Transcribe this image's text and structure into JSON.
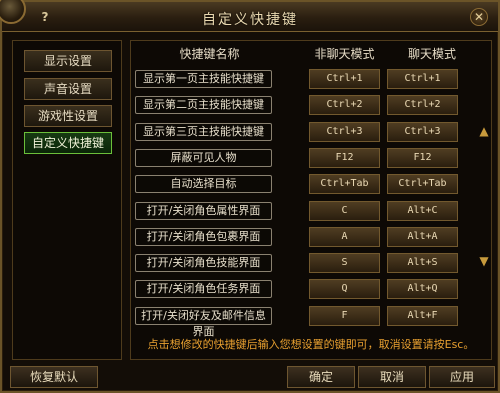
{
  "window": {
    "title": "自定义快捷键",
    "help_label": "?",
    "close_label": "✕"
  },
  "sidebar": {
    "items": [
      {
        "label": "显示设置",
        "active": false
      },
      {
        "label": "声音设置",
        "active": false
      },
      {
        "label": "游戏性设置",
        "active": false
      },
      {
        "label": "自定义快捷键",
        "active": true
      }
    ]
  },
  "table": {
    "headers": [
      "快捷键名称",
      "非聊天模式",
      "聊天模式"
    ],
    "rows": [
      {
        "name": "显示第一页主技能快捷键",
        "normal": "Ctrl+1",
        "chat": "Ctrl+1"
      },
      {
        "name": "显示第二页主技能快捷键",
        "normal": "Ctrl+2",
        "chat": "Ctrl+2"
      },
      {
        "name": "显示第三页主技能快捷键",
        "normal": "Ctrl+3",
        "chat": "Ctrl+3"
      },
      {
        "name": "屏蔽可见人物",
        "normal": "F12",
        "chat": "F12"
      },
      {
        "name": "自动选择目标",
        "normal": "Ctrl+Tab",
        "chat": "Ctrl+Tab"
      },
      {
        "name": "打开/关闭角色属性界面",
        "normal": "C",
        "chat": "Alt+C"
      },
      {
        "name": "打开/关闭角色包裹界面",
        "normal": "A",
        "chat": "Alt+A"
      },
      {
        "name": "打开/关闭角色技能界面",
        "normal": "S",
        "chat": "Alt+S"
      },
      {
        "name": "打开/关闭角色任务界面",
        "normal": "Q",
        "chat": "Alt+Q"
      },
      {
        "name": "打开/关闭好友及邮件信息界面",
        "normal": "F",
        "chat": "Alt+F"
      }
    ],
    "hint": "点击想修改的快捷键后输入您想设置的键即可，取消设置请按Esc。"
  },
  "scroll": {
    "up_icon": "scroll-up-icon",
    "down_icon": "scroll-down-icon"
  },
  "buttons": {
    "restore_default": "恢复默认",
    "ok": "确定",
    "cancel": "取消",
    "apply": "应用"
  },
  "colors": {
    "active_green": "#6bbf3a",
    "hint_orange": "#e8a030",
    "frame_gold": "#6b5428"
  }
}
